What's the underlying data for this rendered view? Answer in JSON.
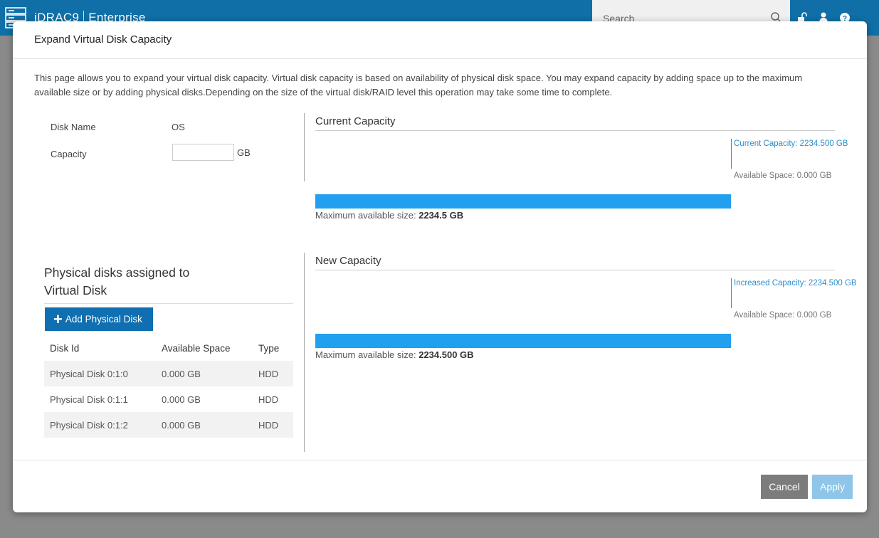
{
  "app": {
    "brand": "iDRAC9",
    "edition": "Enterprise",
    "search_placeholder": "Search"
  },
  "modal": {
    "title": "Expand Virtual Disk Capacity",
    "description": "This page allows you to expand your virtual disk capacity. Virtual disk capacity is based on availability of physical disk space. You may expand capacity by adding space up to the maximum available size or by adding physical disks.Depending on the size of the virtual disk/RAID level this operation may take some time to complete.",
    "disk_name_label": "Disk Name",
    "disk_name_value": "OS",
    "capacity_label": "Capacity",
    "capacity_value": "",
    "capacity_unit": "GB"
  },
  "current_capacity": {
    "title": "Current Capacity",
    "marker_label": "Current Capacity: 2234.500 GB",
    "available_label": "Available Space: 0.000 GB",
    "max_label": "Maximum available size: ",
    "max_value": "2234.5 GB",
    "fill_fraction": 1.0
  },
  "new_capacity": {
    "title": "New Capacity",
    "marker_label": "Increased Capacity: 2234.500 GB",
    "available_label": "Available Space: 0.000 GB",
    "max_label": "Maximum available size: ",
    "max_value": "2234.500 GB",
    "fill_fraction": 1.0
  },
  "physical_disks": {
    "title": "Physical disks assigned to Virtual Disk",
    "add_button": "Add Physical Disk",
    "columns": [
      "Disk Id",
      "Available Space",
      "Type"
    ],
    "rows": [
      [
        "Physical Disk 0:1:0",
        "0.000 GB",
        "HDD"
      ],
      [
        "Physical Disk 0:1:1",
        "0.000 GB",
        "HDD"
      ],
      [
        "Physical Disk 0:1:2",
        "0.000 GB",
        "HDD"
      ]
    ]
  },
  "footer": {
    "cancel_label": "Cancel",
    "apply_label": "Apply"
  },
  "colors": {
    "header_blue": "#0f6fa6",
    "bar_blue": "#21a0f0",
    "button_blue": "#0f6fb0",
    "apply_disabled": "#8ec5e8",
    "cancel_gray": "#7c7c7c"
  }
}
